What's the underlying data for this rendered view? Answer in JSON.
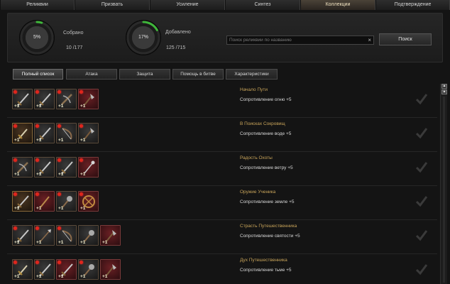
{
  "tabs": [
    {
      "label": "Реликвии",
      "active": false
    },
    {
      "label": "Призвать",
      "active": false
    },
    {
      "label": "Усиление",
      "active": false
    },
    {
      "label": "Синтез",
      "active": false
    },
    {
      "label": "Коллекции",
      "active": true
    },
    {
      "label": "Подтверждение",
      "active": false
    }
  ],
  "header": {
    "collected": {
      "percent_text": "5%",
      "progress": 0.05,
      "label": "Собрано",
      "value": "10 /177"
    },
    "added": {
      "percent_text": "17%",
      "progress": 0.17,
      "label": "Добавлено",
      "value": "125 /715"
    },
    "search": {
      "placeholder": "Поиск реликвии по названию",
      "value": "",
      "clear_icon": "×"
    },
    "search_button": "Поиск"
  },
  "filters": [
    {
      "label": "Полный список",
      "active": true
    },
    {
      "label": "Атака",
      "active": false
    },
    {
      "label": "Защита",
      "active": false
    },
    {
      "label": "Помощь в битве",
      "active": false
    },
    {
      "label": "Характеристики",
      "active": false
    }
  ],
  "scrollbar": {
    "up_icon": "▲",
    "top_icon": "▲"
  },
  "collections": [
    {
      "name": "Начало Пути",
      "bonus": "Сопротивление огню +5",
      "items": [
        {
          "icon": "sword-icon",
          "bg": "dark",
          "plus": "+1",
          "dot": true
        },
        {
          "icon": "sword-icon",
          "bg": "dark",
          "plus": "+1",
          "dot": true
        },
        {
          "icon": "crossbow-icon",
          "bg": "dark",
          "plus": "+1",
          "dot": true
        },
        {
          "icon": "axe-icon",
          "bg": "red",
          "plus": "+1",
          "dot": true
        }
      ]
    },
    {
      "name": "В Поисках Сокровищ",
      "bonus": "Сопротивление воде +5",
      "items": [
        {
          "icon": "dagger-icon",
          "bg": "gold",
          "plus": "+1",
          "dot": true
        },
        {
          "icon": "sword-icon",
          "bg": "dark",
          "plus": "+1",
          "dot": true
        },
        {
          "icon": "bow-icon",
          "bg": "dark",
          "plus": "+1",
          "dot": true
        },
        {
          "icon": "axe-icon",
          "bg": "dark",
          "plus": "+1",
          "dot": true
        }
      ]
    },
    {
      "name": "Радость Охоты",
      "bonus": "Сопротивление ветру +5",
      "items": [
        {
          "icon": "crossbow-icon",
          "bg": "dark",
          "plus": "+1",
          "dot": true
        },
        {
          "icon": "sword-icon",
          "bg": "dark",
          "plus": "+1",
          "dot": true
        },
        {
          "icon": "sword-icon",
          "bg": "dark",
          "plus": "+1",
          "dot": true
        },
        {
          "icon": "staff-icon",
          "bg": "red",
          "plus": "+1",
          "dot": true
        }
      ]
    },
    {
      "name": "Оружие Ученика",
      "bonus": "Сопротивление земле +5",
      "items": [
        {
          "icon": "sword-icon",
          "bg": "gold",
          "plus": "+1",
          "dot": true
        },
        {
          "icon": "wand-icon",
          "bg": "red",
          "plus": "+1",
          "dot": true
        },
        {
          "icon": "mace-icon",
          "bg": "dark",
          "plus": "+1",
          "dot": true
        },
        {
          "icon": "shield-icon",
          "bg": "red",
          "plus": "+1",
          "dot": true
        }
      ]
    },
    {
      "name": "Страсть Путешественника",
      "bonus": "Сопротивление святости +5",
      "items": [
        {
          "icon": "sword-icon",
          "bg": "dark",
          "plus": "+1",
          "dot": true
        },
        {
          "icon": "spear-icon",
          "bg": "dark",
          "plus": "+1",
          "dot": true
        },
        {
          "icon": "bow-icon",
          "bg": "dark",
          "plus": "+1",
          "dot": true
        },
        {
          "icon": "mace-icon",
          "bg": "dark",
          "plus": "+1",
          "dot": false
        },
        {
          "icon": "axe-icon",
          "bg": "red",
          "plus": "+1",
          "dot": false
        }
      ]
    },
    {
      "name": "Дух Путешественника",
      "bonus": "Сопротивление тьме +5",
      "items": [
        {
          "icon": "dagger-icon",
          "bg": "dark",
          "plus": "+1",
          "dot": true
        },
        {
          "icon": "sword-icon",
          "bg": "dark",
          "plus": "+1",
          "dot": true
        },
        {
          "icon": "sword-icon",
          "bg": "red",
          "plus": "+1",
          "dot": true
        },
        {
          "icon": "mace-icon",
          "bg": "dark",
          "plus": "+1",
          "dot": true
        },
        {
          "icon": "axe-icon",
          "bg": "red",
          "plus": "+1",
          "dot": false
        }
      ]
    }
  ]
}
